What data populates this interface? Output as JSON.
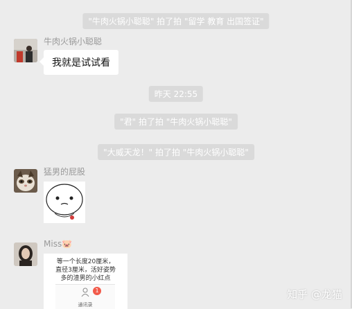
{
  "system_messages": [
    "\"牛肉火锅小聪聪\" 拍了拍 \"留学 教育 出国签证\"",
    "昨天 22:55",
    "\"君\" 拍了拍 \"牛肉火锅小聪聪\"",
    "\"大威天龙！\" 拍了拍 \"牛肉火锅小聪聪\""
  ],
  "messages": [
    {
      "sender": "牛肉火锅小聪聪",
      "text": "我就是试试看"
    },
    {
      "sender": "猛男的屁股"
    },
    {
      "sender": "Miss",
      "sender_emoji": "🐷"
    }
  ],
  "image_card": {
    "text_line1": "等一个长度20厘米，",
    "text_line2": "直径3厘米，活好姿势",
    "text_line3": "多的渣男的小红点",
    "badge_count": "1",
    "tab_label": "通讯录"
  },
  "watermark": "知乎 @龙猫",
  "colors": {
    "background": "#ececec",
    "system_bubble": "#dadada",
    "badge": "#f25a4a"
  }
}
